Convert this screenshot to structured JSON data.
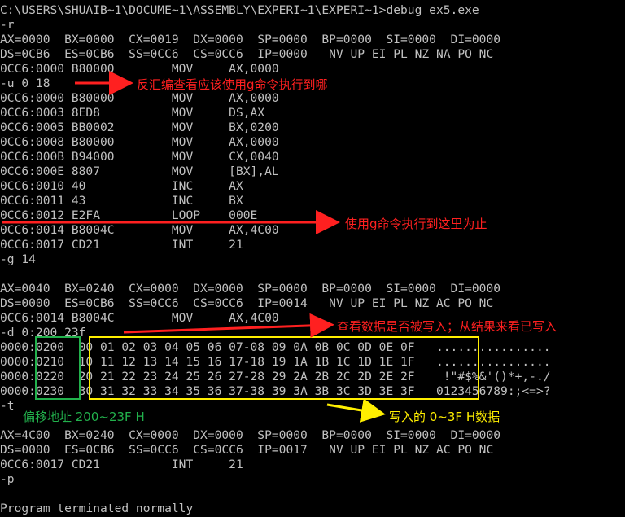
{
  "console": {
    "lines": [
      "C:\\USERS\\SHUAIB~1\\DOCUME~1\\ASSEMBLY\\EXPERI~1\\EXPERI~1>debug ex5.exe",
      "-r",
      "AX=0000  BX=0000  CX=0019  DX=0000  SP=0000  BP=0000  SI=0000  DI=0000",
      "DS=0CB6  ES=0CB6  SS=0CC6  CS=0CC6  IP=0000   NV UP EI PL NZ NA PO NC",
      "0CC6:0000 B80000        MOV     AX,0000",
      "-u 0 18",
      "0CC6:0000 B80000        MOV     AX,0000",
      "0CC6:0003 8ED8          MOV     DS,AX",
      "0CC6:0005 BB0002        MOV     BX,0200",
      "0CC6:0008 B80000        MOV     AX,0000",
      "0CC6:000B B94000        MOV     CX,0040",
      "0CC6:000E 8807          MOV     [BX],AL",
      "0CC6:0010 40            INC     AX",
      "0CC6:0011 43            INC     BX",
      "0CC6:0012 E2FA          LOOP    000E",
      "0CC6:0014 B8004C        MOV     AX,4C00",
      "0CC6:0017 CD21          INT     21",
      "-g 14",
      "",
      "AX=0040  BX=0240  CX=0000  DX=0000  SP=0000  BP=0000  SI=0000  DI=0000",
      "DS=0000  ES=0CB6  SS=0CC6  CS=0CC6  IP=0014   NV UP EI PL NZ AC PO NC",
      "0CC6:0014 B8004C        MOV     AX,4C00",
      "-d 0:200 23f",
      "0000:0200  00 01 02 03 04 05 06 07-08 09 0A 0B 0C 0D 0E 0F   ................",
      "0000:0210  10 11 12 13 14 15 16 17-18 19 1A 1B 1C 1D 1E 1F   ................",
      "0000:0220  20 21 22 23 24 25 26 27-28 29 2A 2B 2C 2D 2E 2F    !\"#$%&'()*+,-./",
      "0000:0230  30 31 32 33 34 35 36 37-38 39 3A 3B 3C 3D 3E 3F   0123456789:;<=>?",
      "-t",
      "",
      "AX=4C00  BX=0240  CX=0000  DX=0000  SP=0000  BP=0000  SI=0000  DI=0000",
      "DS=0000  ES=0CB6  SS=0CC6  CS=0CC6  IP=0017   NV UP EI PL NZ AC PO NC",
      "0CC6:0017 CD21          INT     21",
      "-p",
      "",
      "Program terminated normally"
    ]
  },
  "annotations": {
    "disassemble_note": "反汇编查看应该使用g命令执行到哪",
    "go_until_note": "使用g命令执行到这里为止",
    "check_data_note": "查看数据是否被写入；从结果来看已写入",
    "offset_note": "偏移地址 200~23F H",
    "written_note": "写入的 0~3F H数据"
  },
  "colors": {
    "text": "#c0c0c0",
    "red": "#ff2020",
    "green": "#22b14c",
    "yellow": "#ffef00"
  }
}
